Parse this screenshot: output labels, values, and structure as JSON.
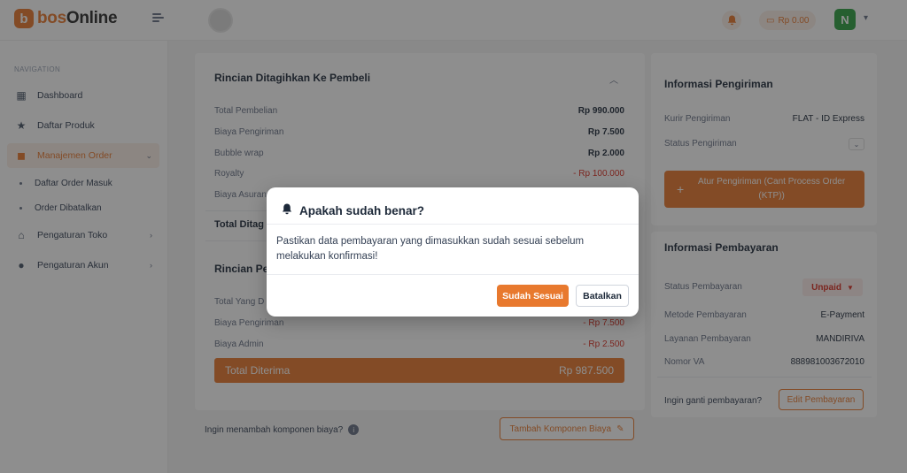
{
  "brand": {
    "logo_letter": "b",
    "name_prefix": "bos",
    "name_suffix": "Online"
  },
  "header": {
    "balance": "Rp 0.00",
    "user_initial": "N"
  },
  "sidebar": {
    "heading": "NAVIGATION",
    "items": [
      {
        "label": "Dashboard",
        "icon": "dashboard-icon"
      },
      {
        "label": "Daftar Produk",
        "icon": "star-icon"
      },
      {
        "label": "Manajemen Order",
        "icon": "bag-icon"
      },
      {
        "label": "Pengaturan Toko",
        "icon": "store-icon"
      },
      {
        "label": "Pengaturan Akun",
        "icon": "user-icon"
      }
    ],
    "subitems": [
      "Daftar Order Masuk",
      "Order Dibatalkan"
    ]
  },
  "billing": {
    "title": "Rincian Ditagihkan Ke Pembeli",
    "rows": [
      {
        "label": "Total Pembelian",
        "value": "Rp 990.000"
      },
      {
        "label": "Biaya Pengiriman",
        "value": "Rp 7.500"
      },
      {
        "label": "Bubble wrap",
        "value": "Rp 2.000"
      },
      {
        "label": "Royalty",
        "value": "- Rp 100.000"
      },
      {
        "label": "Biaya Asuransi",
        "value": ""
      }
    ],
    "total_label": "Total Ditag"
  },
  "received": {
    "title": "Rincian Pen",
    "rows": [
      {
        "label": "Total Yang D",
        "value": ""
      },
      {
        "label": "Biaya Pengiriman",
        "value": "- Rp 7.500"
      },
      {
        "label": "Biaya Admin",
        "value": "- Rp 2.500"
      }
    ],
    "total_label": "Total Diterima",
    "total_value": "Rp 987.500"
  },
  "extra_cost": {
    "question": "Ingin menambah komponen biaya?",
    "button": "Tambah Komponen Biaya"
  },
  "shipping": {
    "title": "Informasi Pengiriman",
    "courier_label": "Kurir Pengiriman",
    "courier_value": "FLAT - ID Express",
    "status_label": "Status Pengiriman",
    "action_button": "Atur Pengiriman (Cant Process Order (KTP))"
  },
  "payment": {
    "title": "Informasi Pembayaran",
    "status_label": "Status Pembayaran",
    "status_value": "Unpaid",
    "method_label": "Metode Pembayaran",
    "method_value": "E-Payment",
    "service_label": "Layanan Pembayaran",
    "service_value": "MANDIRIVA",
    "va_label": "Nomor VA",
    "va_value": "888981003672010",
    "change_question": "Ingin ganti pembayaran?",
    "edit_button": "Edit Pembayaran"
  },
  "dialog": {
    "title": "Apakah sudah benar?",
    "body": "Pastikan data pembayaran yang dimasukkan sudah sesuai sebelum melakukan konfirmasi!",
    "confirm": "Sudah Sesuai",
    "cancel": "Batalkan"
  },
  "colors": {
    "accent": "#e8792e",
    "danger": "#d92d20",
    "success": "#2ea043"
  }
}
